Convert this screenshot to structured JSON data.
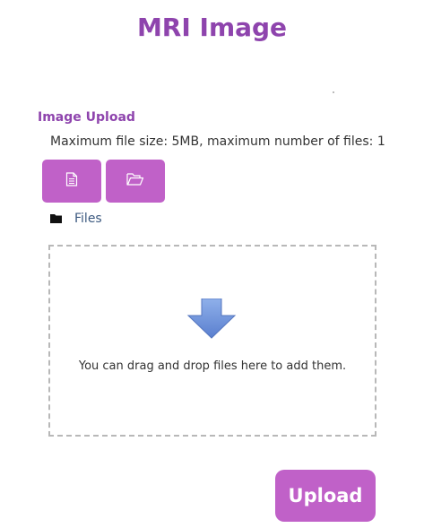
{
  "header": {
    "title": "MRI Image"
  },
  "upload": {
    "section_label": "Image Upload",
    "limits_text": "Maximum file size: 5MB, maximum number of files: 1",
    "file_picker_icon": "file-icon",
    "folder_button_icon": "folder-open-icon",
    "files_label": "Files",
    "dropzone_text": "You can drag and drop files here to add them.",
    "dropzone_icon": "down-arrow-icon"
  },
  "actions": {
    "upload_label": "Upload"
  },
  "colors": {
    "accent": "#8e44ad",
    "button": "#c061c8",
    "arrow": "#6b8fd6"
  }
}
